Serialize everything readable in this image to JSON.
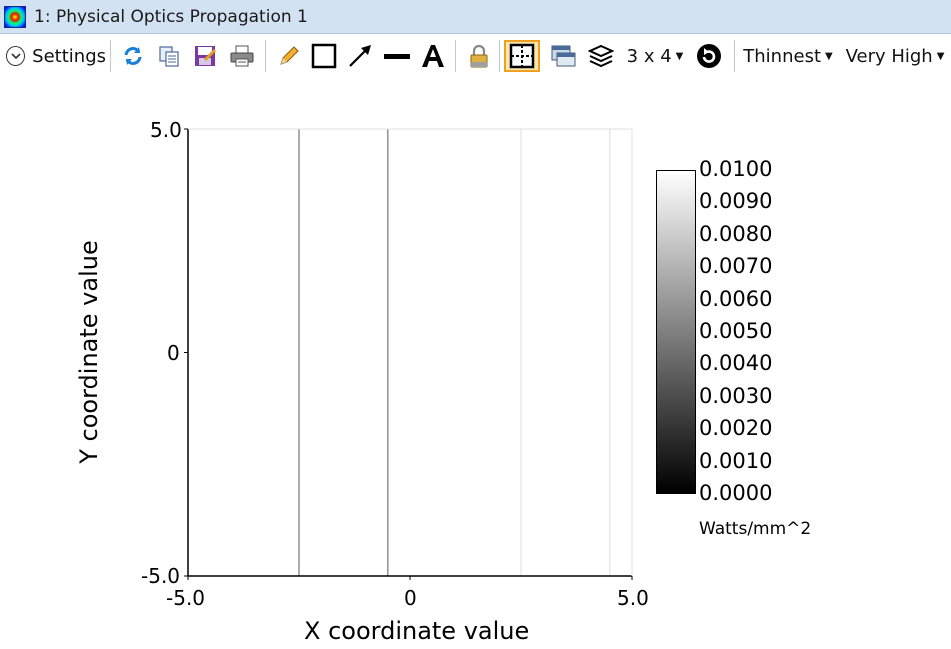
{
  "window": {
    "title": "1: Physical Optics Propagation 1",
    "app_icon": "physical-optics-beam-icon"
  },
  "toolbar": {
    "settings_label": "Settings",
    "grid_label": "3 x 4",
    "line_width_label": "Thinnest",
    "quality_label": "Very High",
    "icons": [
      "refresh-icon",
      "copy-icon",
      "save-icon",
      "print-icon",
      "pencil-icon",
      "rectangle-icon",
      "arrow-icon",
      "line-icon",
      "text-icon",
      "lock-icon",
      "layout-icon",
      "window-icon",
      "layers-icon",
      "rotate-icon"
    ]
  },
  "plot": {
    "x_title": "X coordinate value",
    "y_title": "Y coordinate value",
    "x_ticks": [
      "-5.0",
      "0",
      "5.0"
    ],
    "y_ticks": [
      "5.0",
      "0",
      "-5.0"
    ],
    "units": "Watts/mm^2"
  },
  "colorbar": {
    "labels": [
      "0.0100",
      "0.0090",
      "0.0080",
      "0.0070",
      "0.0060",
      "0.0050",
      "0.0040",
      "0.0030",
      "0.0020",
      "0.0010",
      "0.0000"
    ],
    "top_color": "#ffffff",
    "bottom_color": "#000000"
  },
  "chart_data": {
    "type": "heatmap",
    "x_range": [
      -5.0,
      5.0
    ],
    "y_range": [
      -5.0,
      5.0
    ],
    "value_range": [
      0.0,
      0.01
    ],
    "x_tick_labels": [
      "-5.0",
      "0",
      "5.0"
    ],
    "y_tick_labels": [
      "5.0",
      "0",
      "-5.0"
    ],
    "colorbar_labels": [
      "0.0100",
      "0.0090",
      "0.0080",
      "0.0070",
      "0.0060",
      "0.0050",
      "0.0040",
      "0.0030",
      "0.0020",
      "0.0010",
      "0.0000"
    ],
    "vertical_lines": [
      {
        "x": -2.5,
        "color": "#909090"
      },
      {
        "x": -0.5,
        "color": "#909090"
      },
      {
        "x": 2.5,
        "color": "#e8e8e8"
      },
      {
        "x": 4.5,
        "color": "#e8e8e8"
      }
    ]
  }
}
